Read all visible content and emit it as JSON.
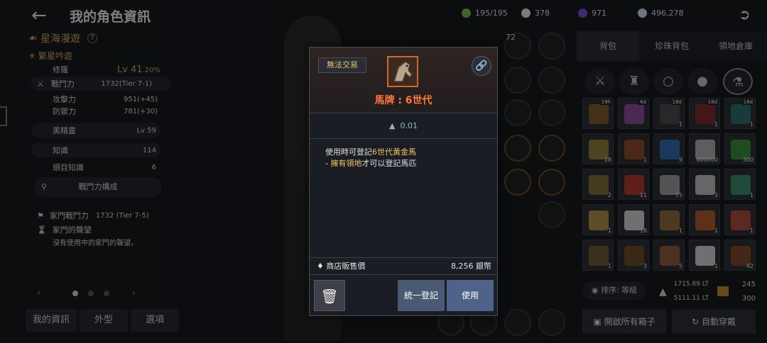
{
  "header": {
    "title": "我的角色資訊"
  },
  "resources": [
    {
      "icon": "energy-icon",
      "value": "195/195",
      "color": "#7fb04a"
    },
    {
      "icon": "pearl-icon",
      "value": "378",
      "color": "#e0e0e0"
    },
    {
      "icon": "crystal-icon",
      "value": "971",
      "color": "#7a4acf"
    },
    {
      "icon": "silver-icon",
      "value": "496,278",
      "color": "#c8d8e8"
    }
  ],
  "character": {
    "family": "星海漫遊",
    "name": "繁星吟遊",
    "class": "修羅",
    "level_label": "Lv 41",
    "level_pct": ".20%",
    "cp_label": "戰鬥力",
    "cp_value": "1732(Tier 7-1)",
    "attack_label": "攻擊力",
    "attack_value": "951(+45)",
    "defense_label": "防禦力",
    "defense_value": "781(+30)",
    "black_spirit_label": "黑精靈",
    "black_spirit_value": "Lv 59",
    "knowledge_label": "知識",
    "knowledge_value": "114",
    "boss_knowledge_label": "頭目知識",
    "boss_knowledge_value": "6",
    "cp_compose": "戰鬥力構成",
    "family_cp_label": "家門戰鬥力",
    "family_cp_value": "1732 (Tier 7-5)",
    "family_fame_label": "家門的聲望",
    "family_fame_note": "沒有使用中的家門的聲望。"
  },
  "bottom_tabs": [
    "我的資訊",
    "外型",
    "選項"
  ],
  "right_tabs": [
    "背包",
    "珍珠背包",
    "領地倉庫"
  ],
  "inventory": {
    "cells": [
      {
        "n": "",
        "tag": "19h",
        "color": "#7a5a2a"
      },
      {
        "n": "",
        "tag": "6d",
        "color": "#8a4a9a"
      },
      {
        "n": "1",
        "tag": "18d",
        "color": "#4a4a4a"
      },
      {
        "n": "1",
        "tag": "18d",
        "color": "#7a2a2a"
      },
      {
        "n": "1",
        "tag": "18d",
        "color": "#2a6a6a"
      },
      {
        "n": "18",
        "tag": "",
        "color": "#8a7a3a"
      },
      {
        "n": "1",
        "tag": "",
        "color": "#8a4a2a"
      },
      {
        "n": "9",
        "tag": "",
        "color": "#2a6aaa"
      },
      {
        "n": "600000",
        "tag": "",
        "color": "#aaaaaa"
      },
      {
        "n": "300",
        "tag": "",
        "color": "#3a8a3a"
      },
      {
        "n": "2",
        "tag": "",
        "color": "#7a6a3a"
      },
      {
        "n": "11",
        "tag": "",
        "color": "#aa3a2a"
      },
      {
        "n": "75",
        "tag": "",
        "color": "#9a9a9a"
      },
      {
        "n": "3",
        "tag": "",
        "color": "#bbbbbb"
      },
      {
        "n": "1",
        "tag": "",
        "color": "#3a8a6a"
      },
      {
        "n": "1",
        "tag": "",
        "color": "#aa8a4a"
      },
      {
        "n": "18",
        "tag": "",
        "color": "#cccccc"
      },
      {
        "n": "1",
        "tag": "",
        "color": "#8a6a3a"
      },
      {
        "n": "1",
        "tag": "",
        "color": "#aa5a2a"
      },
      {
        "n": "1",
        "tag": "",
        "color": "#aa4a3a"
      },
      {
        "n": "1",
        "tag": "",
        "color": "#6a5a3a"
      },
      {
        "n": "3",
        "tag": "",
        "color": "#6a4a2a"
      },
      {
        "n": "5",
        "tag": "",
        "color": "#8a5a3a"
      },
      {
        "n": "1",
        "tag": "",
        "color": "#cccccc"
      },
      {
        "n": "42",
        "tag": "",
        "color": "#7a4a2a"
      }
    ]
  },
  "sort_label": "排序: 等級",
  "weight": {
    "current": "1715.89 LT",
    "max": "5111.11 LT",
    "slots_used": "245",
    "slots_max": "300"
  },
  "open_all_boxes": "開啟所有箱子",
  "auto_equip": "自動穿戴",
  "item_popup": {
    "trade_badge": "無法交易",
    "name": "馬牌 : 6世代",
    "weight": "0.01",
    "desc_prefix": "使用時可登記",
    "desc_highlight": "6世代黃金馬",
    "desc_line2_prefix": "- ",
    "desc_line2_highlight": "擁有領地",
    "desc_line2_suffix": "才可以登記馬匹",
    "sell_price_label": "商店販售價",
    "sell_price_value": "8,256 銀幣",
    "register_all": "統一登記",
    "use": "使用"
  },
  "partial_text": {
    "number_72": "72",
    "number_1": "1"
  }
}
